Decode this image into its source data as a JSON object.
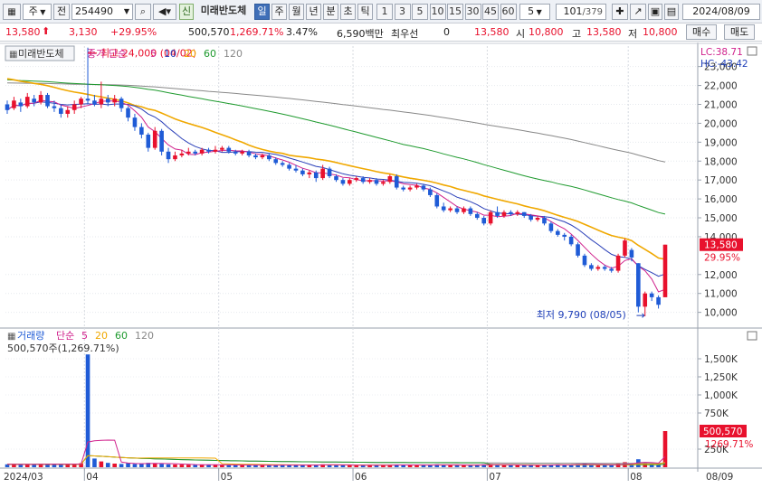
{
  "toolbar": {
    "market_label": "주",
    "prev_label": "전",
    "stock_code": "254490",
    "badge_label": "신",
    "stock_name": "미래반도체",
    "periods": [
      "일",
      "주",
      "월",
      "년",
      "분",
      "초",
      "틱"
    ],
    "active_period": "일",
    "intervals": [
      "1",
      "3",
      "5",
      "10",
      "15",
      "30",
      "45",
      "60"
    ],
    "custom_interval": "5",
    "page_counter": "101",
    "page_total": "/379",
    "date": "2024/08/09"
  },
  "quote": {
    "price": "13,580",
    "change": "3,130",
    "change_pct": "+29.95%",
    "volume": "500,570",
    "volume_pct": "1,269.71%",
    "turnover_pct": "3.47%",
    "amount": "6,590백만",
    "preferred_label": "최우선",
    "preferred_value": "0",
    "best_price": "13,580",
    "open_label": "시",
    "open": "10,800",
    "high_label": "고",
    "high": "13,580",
    "low_label": "저",
    "low": "10,800",
    "buy_label": "매수",
    "sell_label": "매도"
  },
  "price_panel": {
    "name_tag": "미래반도체",
    "legend_title": "종가 단순",
    "ma_labels": [
      "5",
      "10",
      "20",
      "60",
      "120"
    ],
    "ma_colors": [
      "#d0218c",
      "#2a3fb8",
      "#f0a800",
      "#1e9a2e",
      "#888888"
    ],
    "lc_label": "LC:38.71",
    "hc_label": "HC:-43.42",
    "high_annotation": "최고 24,000 (04/02)",
    "low_annotation": "최저 9,790 (08/05)",
    "y_ticks": [
      "23,000",
      "22,000",
      "21,000",
      "20,000",
      "19,000",
      "18,000",
      "17,000",
      "16,000",
      "15,000",
      "14,000",
      "12,000",
      "11,000",
      "10,000"
    ],
    "current_price_tag": "13,580",
    "current_pct_tag": "29.95%"
  },
  "volume_panel": {
    "legend_title": "거래량",
    "legend_ma": "단순",
    "ma_labels": [
      "5",
      "20",
      "60",
      "120"
    ],
    "ma_colors": [
      "#d0218c",
      "#f0a800",
      "#1e9a2e",
      "#888888"
    ],
    "volume_readout": "500,570주(1,269.71%)",
    "y_ticks": [
      "1,500K",
      "1,250K",
      "1,000K",
      "750K",
      "250K"
    ],
    "current_volume_tag": "500,570",
    "current_pct_tag": "1269.71%"
  },
  "x_axis": {
    "labels": [
      "2024/03",
      "04",
      "05",
      "06",
      "07",
      "08",
      "08/09"
    ]
  },
  "colors": {
    "up": "#e8112d",
    "down": "#1f5bd6",
    "ma5": "#d0218c",
    "ma10": "#2a3fb8",
    "ma20": "#f0a800",
    "ma60": "#1e9a2e",
    "ma120": "#888888"
  },
  "chart_data": {
    "type": "candlestick",
    "y_range": [
      9600,
      23700
    ],
    "series_price": [
      {
        "o": 21000,
        "c": 20700,
        "h": 21200,
        "l": 20500
      },
      {
        "o": 20800,
        "c": 21200,
        "h": 21400,
        "l": 20700
      },
      {
        "o": 21100,
        "c": 20900,
        "h": 21300,
        "l": 20600
      },
      {
        "o": 20900,
        "c": 21400,
        "h": 21600,
        "l": 20800
      },
      {
        "o": 21300,
        "c": 21100,
        "h": 21500,
        "l": 20900
      },
      {
        "o": 21100,
        "c": 21500,
        "h": 21700,
        "l": 21000
      },
      {
        "o": 21500,
        "c": 20900,
        "h": 21600,
        "l": 20800
      },
      {
        "o": 20900,
        "c": 20800,
        "h": 21200,
        "l": 20600
      },
      {
        "o": 20800,
        "c": 20500,
        "h": 21000,
        "l": 20300
      },
      {
        "o": 20500,
        "c": 20700,
        "h": 20900,
        "l": 20300
      },
      {
        "o": 20700,
        "c": 21000,
        "h": 21200,
        "l": 20500
      },
      {
        "o": 21000,
        "c": 21300,
        "h": 21400,
        "l": 20800
      },
      {
        "o": 21300,
        "c": 21200,
        "h": 24000,
        "l": 21000
      },
      {
        "o": 21200,
        "c": 21000,
        "h": 21500,
        "l": 20900
      },
      {
        "o": 21000,
        "c": 21300,
        "h": 22200,
        "l": 20800
      },
      {
        "o": 21300,
        "c": 21100,
        "h": 21500,
        "l": 20900
      },
      {
        "o": 21100,
        "c": 21300,
        "h": 21500,
        "l": 20900
      },
      {
        "o": 21300,
        "c": 20800,
        "h": 21400,
        "l": 20600
      },
      {
        "o": 20800,
        "c": 20300,
        "h": 20900,
        "l": 20100
      },
      {
        "o": 20300,
        "c": 19800,
        "h": 20500,
        "l": 19600
      },
      {
        "o": 19800,
        "c": 19400,
        "h": 20000,
        "l": 19200
      },
      {
        "o": 19400,
        "c": 18700,
        "h": 19500,
        "l": 18500
      },
      {
        "o": 18700,
        "c": 19600,
        "h": 19800,
        "l": 18600
      },
      {
        "o": 19600,
        "c": 18500,
        "h": 19700,
        "l": 18300
      },
      {
        "o": 18500,
        "c": 18100,
        "h": 18700,
        "l": 17900
      },
      {
        "o": 18100,
        "c": 18300,
        "h": 18500,
        "l": 18000
      },
      {
        "o": 18300,
        "c": 18400,
        "h": 18600,
        "l": 18200
      },
      {
        "o": 18400,
        "c": 18500,
        "h": 18700,
        "l": 18300
      },
      {
        "o": 18500,
        "c": 18400,
        "h": 18600,
        "l": 18300
      },
      {
        "o": 18400,
        "c": 18600,
        "h": 18700,
        "l": 18300
      },
      {
        "o": 18600,
        "c": 18500,
        "h": 18700,
        "l": 18400
      },
      {
        "o": 18500,
        "c": 18600,
        "h": 18800,
        "l": 18400
      },
      {
        "o": 18600,
        "c": 18700,
        "h": 18800,
        "l": 18500
      },
      {
        "o": 18700,
        "c": 18500,
        "h": 18800,
        "l": 18400
      },
      {
        "o": 18500,
        "c": 18400,
        "h": 18600,
        "l": 18300
      },
      {
        "o": 18400,
        "c": 18500,
        "h": 18600,
        "l": 18300
      },
      {
        "o": 18500,
        "c": 18300,
        "h": 18600,
        "l": 18200
      },
      {
        "o": 18300,
        "c": 18200,
        "h": 18400,
        "l": 18100
      },
      {
        "o": 18200,
        "c": 18300,
        "h": 18400,
        "l": 18100
      },
      {
        "o": 18300,
        "c": 18100,
        "h": 18400,
        "l": 18000
      },
      {
        "o": 18100,
        "c": 17900,
        "h": 18200,
        "l": 17800
      },
      {
        "o": 17900,
        "c": 17800,
        "h": 18000,
        "l": 17700
      },
      {
        "o": 17800,
        "c": 17600,
        "h": 17900,
        "l": 17500
      },
      {
        "o": 17600,
        "c": 17500,
        "h": 17800,
        "l": 17400
      },
      {
        "o": 17500,
        "c": 17300,
        "h": 17600,
        "l": 17200
      },
      {
        "o": 17300,
        "c": 17400,
        "h": 17500,
        "l": 17100
      },
      {
        "o": 17400,
        "c": 17100,
        "h": 17500,
        "l": 16900
      },
      {
        "o": 17100,
        "c": 17600,
        "h": 17800,
        "l": 17000
      },
      {
        "o": 17600,
        "c": 17200,
        "h": 17700,
        "l": 17100
      },
      {
        "o": 17200,
        "c": 17000,
        "h": 17300,
        "l": 16900
      },
      {
        "o": 17000,
        "c": 16800,
        "h": 17100,
        "l": 16700
      },
      {
        "o": 16800,
        "c": 17000,
        "h": 17100,
        "l": 16700
      },
      {
        "o": 17000,
        "c": 17100,
        "h": 17200,
        "l": 16900
      },
      {
        "o": 17100,
        "c": 16900,
        "h": 17200,
        "l": 16800
      },
      {
        "o": 16900,
        "c": 17000,
        "h": 17100,
        "l": 16800
      },
      {
        "o": 17000,
        "c": 16800,
        "h": 17100,
        "l": 16700
      },
      {
        "o": 16800,
        "c": 16900,
        "h": 17000,
        "l": 16700
      },
      {
        "o": 16900,
        "c": 17200,
        "h": 17300,
        "l": 16800
      },
      {
        "o": 17200,
        "c": 16600,
        "h": 17300,
        "l": 16500
      },
      {
        "o": 16600,
        "c": 16500,
        "h": 16700,
        "l": 16400
      },
      {
        "o": 16500,
        "c": 16600,
        "h": 16700,
        "l": 16400
      },
      {
        "o": 16600,
        "c": 16700,
        "h": 16800,
        "l": 16500
      },
      {
        "o": 16700,
        "c": 16500,
        "h": 16800,
        "l": 16400
      },
      {
        "o": 16500,
        "c": 16200,
        "h": 16600,
        "l": 16100
      },
      {
        "o": 16200,
        "c": 15600,
        "h": 16300,
        "l": 15500
      },
      {
        "o": 15600,
        "c": 15400,
        "h": 15800,
        "l": 15300
      },
      {
        "o": 15400,
        "c": 15500,
        "h": 15600,
        "l": 15300
      },
      {
        "o": 15500,
        "c": 15300,
        "h": 15600,
        "l": 15200
      },
      {
        "o": 15300,
        "c": 15500,
        "h": 15600,
        "l": 15200
      },
      {
        "o": 15500,
        "c": 15200,
        "h": 15600,
        "l": 15100
      },
      {
        "o": 15200,
        "c": 15000,
        "h": 15300,
        "l": 14900
      },
      {
        "o": 15000,
        "c": 14700,
        "h": 15100,
        "l": 14600
      },
      {
        "o": 14700,
        "c": 15300,
        "h": 15400,
        "l": 14600
      },
      {
        "o": 15300,
        "c": 15100,
        "h": 15600,
        "l": 15000
      },
      {
        "o": 15100,
        "c": 15300,
        "h": 15400,
        "l": 15000
      },
      {
        "o": 15300,
        "c": 15200,
        "h": 15400,
        "l": 15100
      },
      {
        "o": 15200,
        "c": 15300,
        "h": 15400,
        "l": 15100
      },
      {
        "o": 15300,
        "c": 15100,
        "h": 15300,
        "l": 15000
      },
      {
        "o": 15100,
        "c": 14900,
        "h": 15200,
        "l": 14800
      },
      {
        "o": 14900,
        "c": 15000,
        "h": 15100,
        "l": 14800
      },
      {
        "o": 15000,
        "c": 14700,
        "h": 15100,
        "l": 14600
      },
      {
        "o": 14700,
        "c": 14300,
        "h": 14800,
        "l": 14200
      },
      {
        "o": 14300,
        "c": 14100,
        "h": 14400,
        "l": 14000
      },
      {
        "o": 14100,
        "c": 14000,
        "h": 14200,
        "l": 13800
      },
      {
        "o": 14000,
        "c": 13600,
        "h": 14100,
        "l": 13500
      },
      {
        "o": 13600,
        "c": 13000,
        "h": 13700,
        "l": 12900
      },
      {
        "o": 13000,
        "c": 12500,
        "h": 13100,
        "l": 12400
      },
      {
        "o": 12500,
        "c": 12300,
        "h": 12600,
        "l": 12200
      },
      {
        "o": 12300,
        "c": 12400,
        "h": 12500,
        "l": 12200
      },
      {
        "o": 12400,
        "c": 12300,
        "h": 12500,
        "l": 12200
      },
      {
        "o": 12300,
        "c": 12200,
        "h": 12400,
        "l": 12100
      },
      {
        "o": 12200,
        "c": 13000,
        "h": 13100,
        "l": 12100
      },
      {
        "o": 13000,
        "c": 13800,
        "h": 13900,
        "l": 12900
      },
      {
        "o": 13300,
        "c": 12900,
        "h": 13400,
        "l": 12700
      },
      {
        "o": 12600,
        "c": 10300,
        "h": 12600,
        "l": 10000
      },
      {
        "o": 10300,
        "c": 11000,
        "h": 11100,
        "l": 9790
      },
      {
        "o": 11000,
        "c": 10800,
        "h": 11100,
        "l": 10600
      },
      {
        "o": 10800,
        "c": 10400,
        "h": 10900,
        "l": 10200
      },
      {
        "o": 10800,
        "c": 13580,
        "h": 13580,
        "l": 10800
      }
    ],
    "series_volume_k": [
      40,
      40,
      35,
      40,
      38,
      45,
      50,
      40,
      35,
      42,
      45,
      55,
      1560,
      120,
      80,
      60,
      50,
      45,
      55,
      45,
      50,
      60,
      55,
      48,
      40,
      38,
      36,
      35,
      32,
      34,
      33,
      35,
      30,
      28,
      32,
      30,
      28,
      30,
      27,
      29,
      32,
      34,
      30,
      28,
      29,
      30,
      35,
      40,
      32,
      30,
      28,
      30,
      26,
      28,
      30,
      26,
      30,
      32,
      38,
      30,
      28,
      30,
      28,
      35,
      40,
      30,
      28,
      30,
      26,
      30,
      35,
      40,
      45,
      32,
      30,
      28,
      30,
      26,
      30,
      28,
      30,
      35,
      40,
      30,
      35,
      45,
      50,
      35,
      30,
      28,
      26,
      55,
      70,
      45,
      110,
      60,
      35,
      30,
      500
    ]
  }
}
